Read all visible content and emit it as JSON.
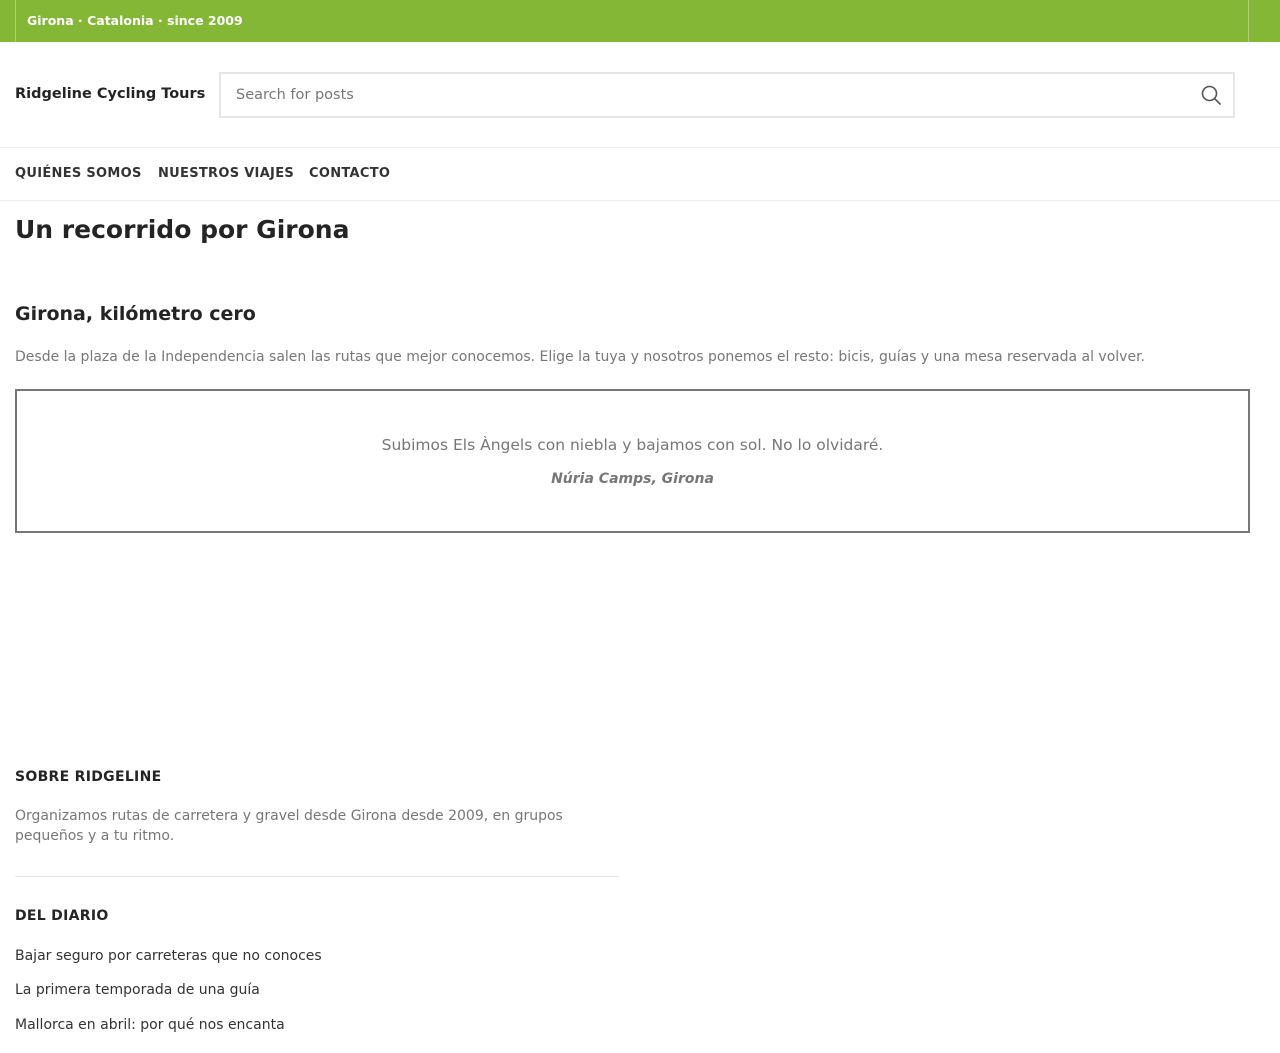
{
  "topbar": {
    "text": "Girona · Catalonia · since 2009"
  },
  "header": {
    "brand": "Ridgeline Cycling Tours",
    "search": {
      "placeholder": "Search for posts",
      "value": "",
      "icon": "search-icon"
    }
  },
  "nav": {
    "items": [
      {
        "label": "QUIÉNES SOMOS"
      },
      {
        "label": "NUESTROS VIAJES"
      },
      {
        "label": "CONTACTO"
      }
    ]
  },
  "main": {
    "page_title": "Un recorrido por Girona",
    "section_title": "Girona, kilómetro cero",
    "intro": "Desde la plaza de la Independencia salen las rutas que mejor conocemos. Elige la tuya y nosotros ponemos el resto: bicis, guías y una mesa reservada al volver.",
    "testimonial": {
      "quote": "Subimos Els Àngels con niebla y bajamos con sol. No lo olvidaré.",
      "author": "Núria Camps, Girona"
    }
  },
  "footer": {
    "about": {
      "heading": "SOBRE RIDGELINE",
      "text": "Organizamos rutas de carretera y gravel desde Girona desde 2009, en grupos pequeños y a tu ritmo."
    },
    "diary": {
      "heading": "DEL DIARIO",
      "posts": [
        {
          "title": "Bajar seguro por carreteras que no conoces"
        },
        {
          "title": "La primera temporada de una guía"
        },
        {
          "title": "Mallorca en abril: por qué nos encanta"
        }
      ]
    }
  },
  "colors": {
    "accent": "#83b735",
    "text": "#242424",
    "muted": "#777777"
  }
}
